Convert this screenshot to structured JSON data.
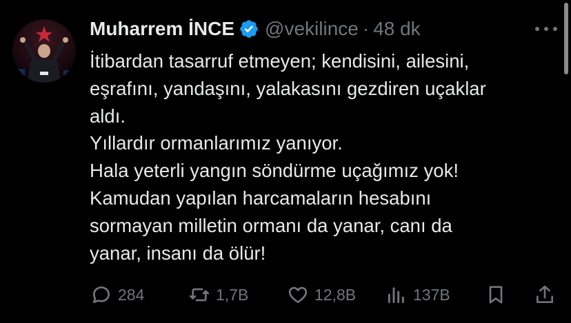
{
  "author": {
    "name": "Muharrem İNCE",
    "handle": "@vekilince",
    "separator": "·",
    "time": "48 dk",
    "verified": true,
    "verified_color": "#1d9bf0"
  },
  "tweet": {
    "lines": [
      "İtibardan tasarruf etmeyen; kendisini, ailesini,",
      "eşrafını, yandaşını, yalakasını gezdiren uçaklar",
      "aldı.",
      "Yıllardır ormanlarımız yanıyor.",
      "Hala yeterli yangın söndürme uçağımız yok!",
      "Kamudan yapılan harcamaların hesabını",
      "sormayan milletin ormanı da yanar, canı da",
      "yanar, insanı da ölür!"
    ]
  },
  "actions": {
    "replies": "284",
    "retweets": "1,7B",
    "likes": "12,8B",
    "views": "137B"
  },
  "icons": {
    "reply": "reply-icon",
    "retweet": "retweet-icon",
    "like": "heart-icon",
    "views": "views-icon",
    "bookmark": "bookmark-icon",
    "share": "share-icon",
    "more": "more-icon"
  },
  "colors": {
    "background": "#000000",
    "text": "#e7e9ea",
    "muted": "#71767b"
  }
}
